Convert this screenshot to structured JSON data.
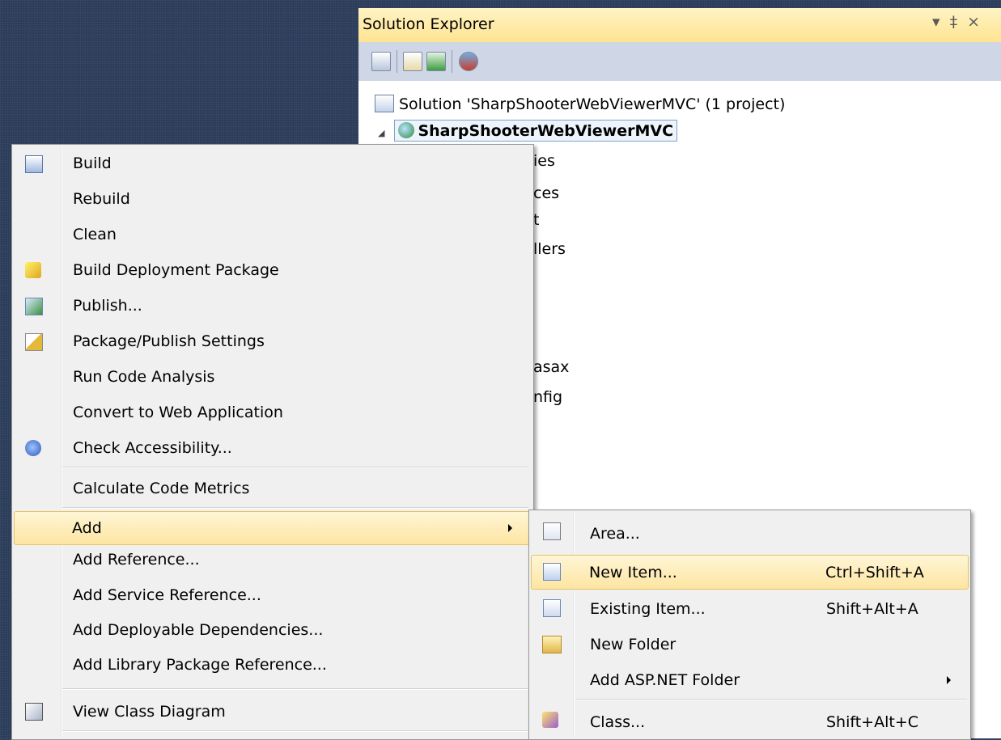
{
  "solution_explorer": {
    "title": "Solution Explorer",
    "title_controls": [
      "▾",
      "‡",
      "×"
    ],
    "toolbar_icons": [
      "properties-icon",
      "show-all-files-icon",
      "refresh-icon",
      "view-class-diagram-icon"
    ],
    "tree": {
      "solution": "Solution 'SharpShooterWebViewerMVC' (1 project)",
      "project": "SharpShooterWebViewerMVC",
      "partial_items": [
        "ies",
        "ces",
        "t",
        "llers",
        "asax",
        "nfig"
      ]
    }
  },
  "context_menu": {
    "items": [
      {
        "label": "Build",
        "icon": "build-icon"
      },
      {
        "label": "Rebuild"
      },
      {
        "label": "Clean"
      },
      {
        "label": "Build Deployment Package",
        "icon": "package-icon"
      },
      {
        "label": "Publish...",
        "icon": "publish-icon"
      },
      {
        "label": "Package/Publish Settings",
        "icon": "package-settings-icon"
      },
      {
        "label": "Run Code Analysis"
      },
      {
        "label": "Convert to Web Application"
      },
      {
        "label": "Check Accessibility...",
        "icon": "accessibility-icon"
      },
      {
        "label": "Calculate Code Metrics"
      },
      {
        "label": "Add",
        "submenu": true,
        "highlighted": true
      },
      {
        "label": "Add Reference..."
      },
      {
        "label": "Add Service Reference..."
      },
      {
        "label": "Add Deployable Dependencies..."
      },
      {
        "label": "Add Library Package Reference..."
      },
      {
        "label": "View Class Diagram",
        "icon": "class-diagram-icon"
      }
    ]
  },
  "add_submenu": {
    "items": [
      {
        "label": "Area...",
        "shortcut": "",
        "icon": "area-icon"
      },
      {
        "label": "New Item...",
        "shortcut": "Ctrl+Shift+A",
        "icon": "new-item-icon",
        "highlighted": true
      },
      {
        "label": "Existing Item...",
        "shortcut": "Shift+Alt+A",
        "icon": "existing-item-icon"
      },
      {
        "label": "New Folder",
        "shortcut": "",
        "icon": "new-folder-icon"
      },
      {
        "label": "Add ASP.NET Folder",
        "shortcut": "",
        "submenu": true
      },
      {
        "label": "Class...",
        "shortcut": "Shift+Alt+C",
        "icon": "class-icon"
      }
    ]
  },
  "colors": {
    "highlight_top": "#fff6d6",
    "highlight_bottom": "#fde5a2",
    "highlight_border": "#e5c365",
    "menu_bg": "#f0f0f0",
    "title_bar": "#ffe391",
    "toolbar_bg": "#cfd6e5",
    "desktop_bg": "#2b3c59"
  }
}
